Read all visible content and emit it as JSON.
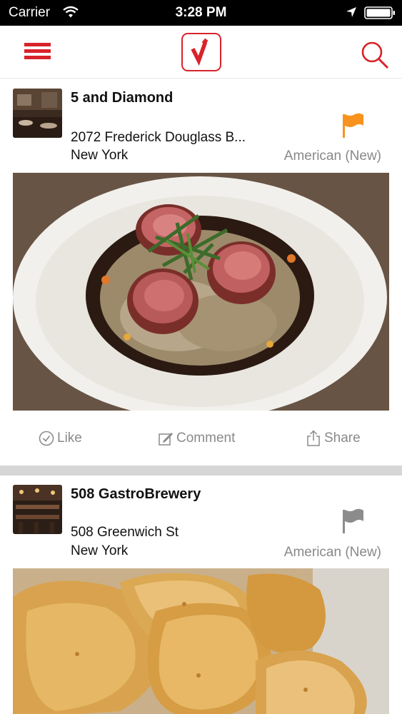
{
  "status_bar": {
    "carrier": "Carrier",
    "time": "3:28 PM"
  },
  "theme": {
    "accent": "#d8232a",
    "flag_active": "#f7931e",
    "flag_inactive": "#8c8c8c",
    "muted_text": "#888888"
  },
  "nav": {
    "menu_icon": "hamburger-icon",
    "logo_icon": "checkmark-logo",
    "search_icon": "search-icon"
  },
  "feed": [
    {
      "name": "5 and Diamond",
      "address": "2072 Frederick Douglass B...",
      "city": "New York",
      "cuisine": "American (New)",
      "flag": "orange",
      "actions": {
        "like": "Like",
        "comment": "Comment",
        "share": "Share"
      }
    },
    {
      "name": "508 GastroBrewery",
      "address": "508 Greenwich St",
      "city": "New York",
      "cuisine": "American (New)",
      "flag": "gray"
    }
  ]
}
